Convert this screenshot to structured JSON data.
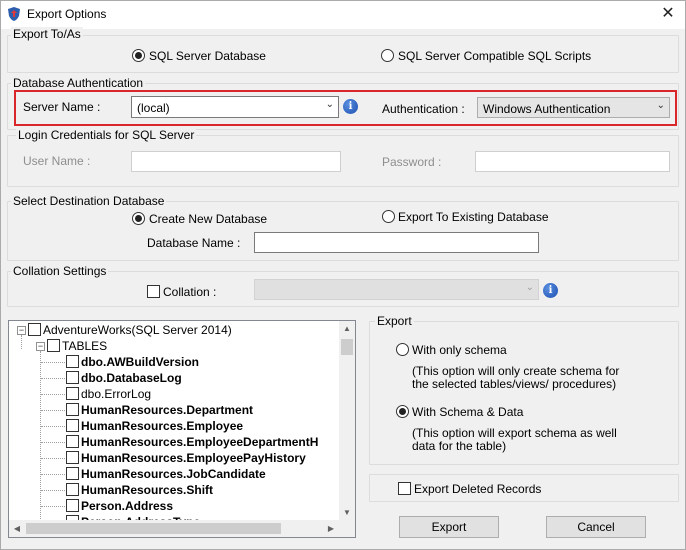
{
  "window": {
    "title": "Export Options",
    "close_glyph": "✕"
  },
  "export_to": {
    "group_title": "Export To/As",
    "sql_server_database": {
      "label": "SQL Server Database",
      "checked": true
    },
    "sql_scripts": {
      "label": "SQL Server Compatible SQL Scripts",
      "checked": false
    }
  },
  "db_auth": {
    "group_title": "Database Authentication",
    "server_name_label": "Server Name :",
    "server_name_value": "(local)",
    "authentication_label": "Authentication :",
    "authentication_value": "Windows Authentication",
    "highlight_color": "#d9262b"
  },
  "login": {
    "group_title": "Login Credentials for SQL Server",
    "user_name_label": "User Name :",
    "password_label": "Password :",
    "user_name_value": "",
    "password_value": ""
  },
  "destination": {
    "group_title": "Select Destination Database",
    "create_new": {
      "label": "Create New Database",
      "checked": true
    },
    "export_existing": {
      "label": "Export To Existing Database",
      "checked": false
    },
    "database_name_label": "Database Name :",
    "database_name_value": ""
  },
  "collation": {
    "group_title": "Collation Settings",
    "checkbox_label": "Collation :",
    "checked": false,
    "value": ""
  },
  "tree": {
    "root": "AdventureWorks(SQL Server 2014)",
    "folder": "TABLES",
    "items": [
      {
        "label": "dbo.AWBuildVersion",
        "bold": true
      },
      {
        "label": "dbo.DatabaseLog",
        "bold": true
      },
      {
        "label": "dbo.ErrorLog",
        "bold": false
      },
      {
        "label": "HumanResources.Department",
        "bold": true
      },
      {
        "label": "HumanResources.Employee",
        "bold": true
      },
      {
        "label": "HumanResources.EmployeeDepartmentH",
        "bold": true
      },
      {
        "label": "HumanResources.EmployeePayHistory",
        "bold": true
      },
      {
        "label": "HumanResources.JobCandidate",
        "bold": true
      },
      {
        "label": "HumanResources.Shift",
        "bold": true
      },
      {
        "label": "Person.Address",
        "bold": true
      },
      {
        "label": "Person.AddressType",
        "bold": true
      }
    ]
  },
  "export_panel": {
    "group_title": "Export",
    "only_schema": {
      "label": "With only schema",
      "checked": false,
      "desc_line1": "(This option will only create schema for",
      "desc_line2": "the  selected tables/views/ procedures)"
    },
    "schema_data": {
      "label": "With Schema & Data",
      "checked": true,
      "desc_line1": "(This option will export schema as well",
      "desc_line2": "data for the table)"
    }
  },
  "export_deleted": {
    "label": "Export Deleted Records",
    "checked": false
  },
  "buttons": {
    "export": "Export",
    "cancel": "Cancel"
  }
}
